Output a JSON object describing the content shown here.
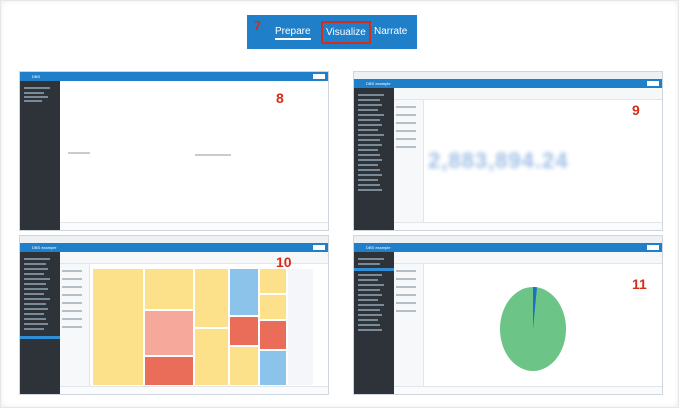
{
  "nav": {
    "step": "7",
    "tabs": [
      "Prepare",
      "Visualize",
      "Narrate"
    ],
    "active_tab": "Prepare",
    "highlighted_tab": "Visualize",
    "color": "#1f7fc8",
    "highlight_color": "#d62c1a"
  },
  "panels": [
    {
      "number": "8",
      "title": "DBS",
      "chart_type": "blank canvas"
    },
    {
      "number": "9",
      "title": "DBS example",
      "chart_type": "tile",
      "metric": "2,883,894.24"
    },
    {
      "number": "10",
      "title": "DBS example",
      "chart_type": "treemap",
      "colors": [
        "#fde08a",
        "#f6a89a",
        "#ea6d5a",
        "#8cc3ea"
      ]
    },
    {
      "number": "11",
      "title": "DBS example",
      "chart_type": "pie",
      "colors": [
        "#6cc486",
        "#1f6fc4"
      ]
    }
  ]
}
